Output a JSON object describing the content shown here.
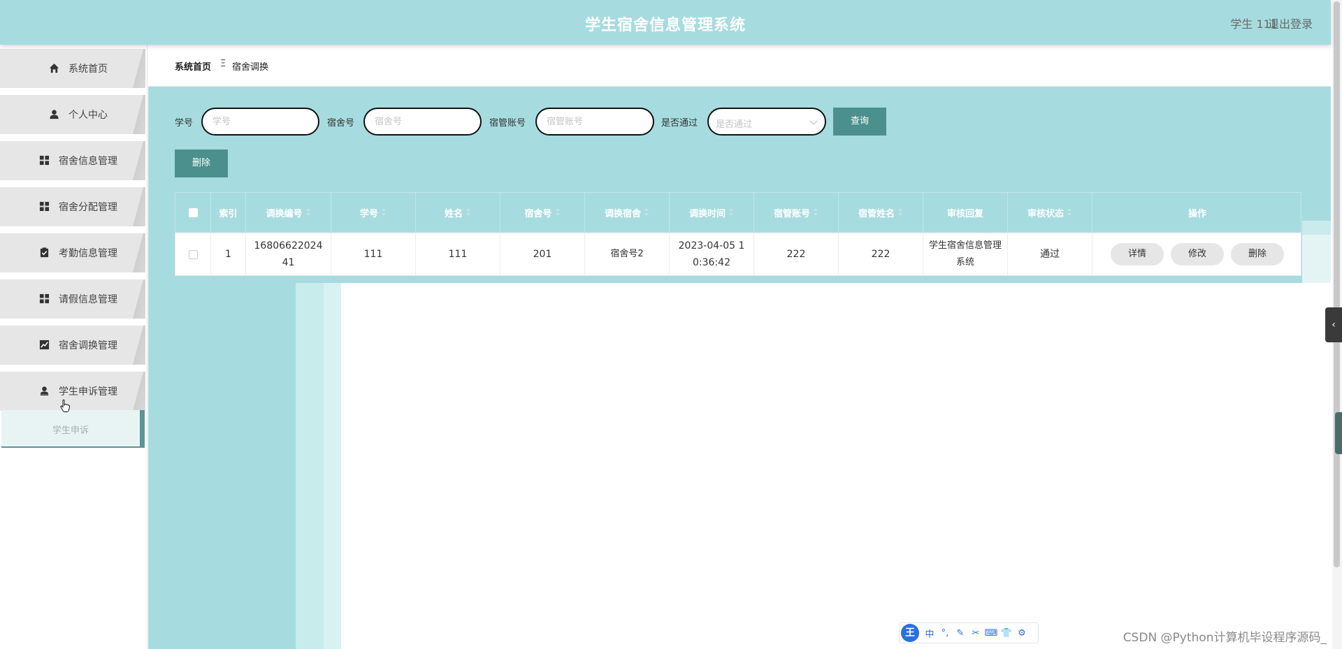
{
  "header": {
    "title": "学生宿舍信息管理系统",
    "user_label": "学生 111",
    "logout_label": "退出登录"
  },
  "sidebar": {
    "items": [
      {
        "label": "系统首页",
        "icon": "home-icon"
      },
      {
        "label": "个人中心",
        "icon": "person-icon"
      },
      {
        "label": "宿舍信息管理",
        "icon": "grid-icon"
      },
      {
        "label": "宿舍分配管理",
        "icon": "grid-icon"
      },
      {
        "label": "考勤信息管理",
        "icon": "clipboard-check-icon"
      },
      {
        "label": "请假信息管理",
        "icon": "grid-icon"
      },
      {
        "label": "宿舍调换管理",
        "icon": "trend-chart-icon"
      },
      {
        "label": "学生申诉管理",
        "icon": "user-badge-icon"
      }
    ],
    "submenu": {
      "label": "学生申诉"
    }
  },
  "breadcrumb": {
    "home": "系统首页",
    "separator": "Ξ",
    "current": "宿舍调换"
  },
  "search": {
    "student_no_label": "学号",
    "student_no_placeholder": "学号",
    "dorm_no_label": "宿舍号",
    "dorm_no_placeholder": "宿舍号",
    "manager_account_label": "宿管账号",
    "manager_account_placeholder": "宿管账号",
    "approved_label": "是否通过",
    "approved_placeholder": "是否通过",
    "query_button": "查询",
    "delete_button": "删除"
  },
  "table": {
    "columns": [
      "索引",
      "调换编号",
      "学号",
      "姓名",
      "宿舍号",
      "调换宿舍",
      "调换时间",
      "宿管账号",
      "宿管姓名",
      "审核回复",
      "审核状态",
      "操作"
    ],
    "rows": [
      {
        "index": "1",
        "swap_no": "1680662202441",
        "student_no": "111",
        "name": "111",
        "dorm_no": "201",
        "target_dorm": "宿舍号2",
        "swap_time": "2023-04-05 10:36:42",
        "manager_account": "222",
        "manager_name": "222",
        "review_reply": "学生宿舍信息管理系统",
        "review_status": "通过",
        "actions": [
          "详情",
          "修改",
          "删除"
        ]
      }
    ]
  },
  "ime_toolbar": {
    "logo": "王",
    "items": [
      "中",
      "°,",
      "✎",
      "✂",
      "⌨",
      "👕",
      "⚙"
    ]
  },
  "watermark": "CSDN @Python计算机毕设程序源码_",
  "colors": {
    "accent": "#a6dcdf",
    "button": "#4b908d",
    "sidebar_item": "#e6e6e6"
  }
}
